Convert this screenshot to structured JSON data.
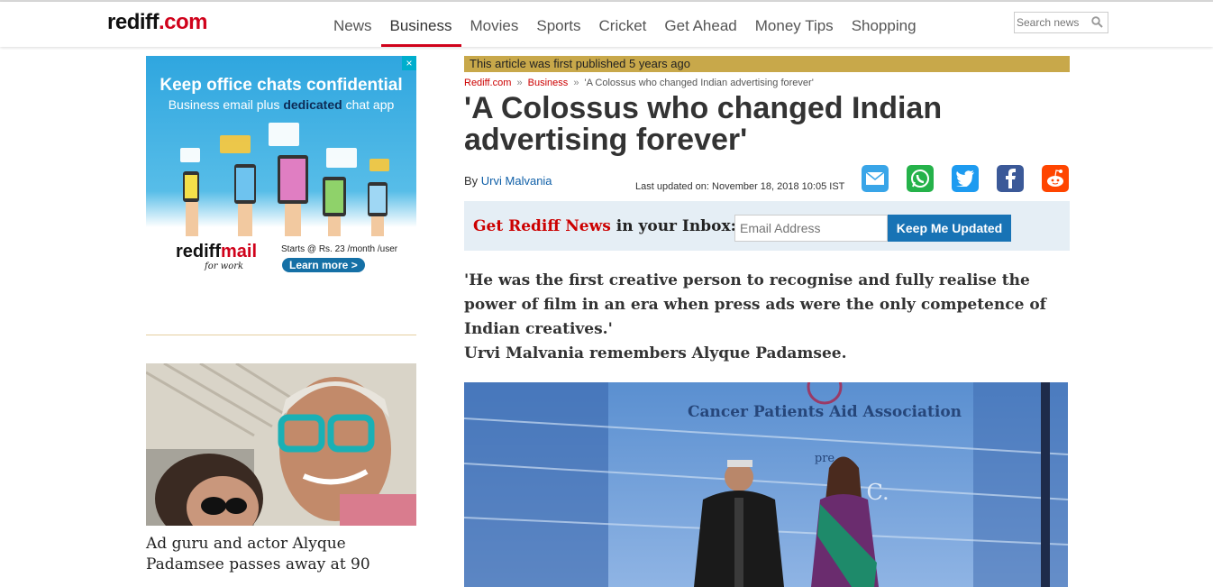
{
  "header": {
    "logo_main": "rediff",
    "logo_suffix": ".com",
    "nav": [
      "News",
      "Business",
      "Movies",
      "Sports",
      "Cricket",
      "Get Ahead",
      "Money Tips",
      "Shopping"
    ],
    "active_nav": "Business",
    "search_placeholder": "Search news"
  },
  "ad": {
    "close": "×",
    "headline": "Keep office chats confidential",
    "sub_before": "Business email plus ",
    "sub_strong": "dedicated",
    "sub_after": " chat app",
    "brand_a": "rediff",
    "brand_b": "mail",
    "brand_tag": "for work",
    "price": "Starts @ Rs. 23 /month /user",
    "cta": "Learn more >"
  },
  "sidebar_story": {
    "caption": "Ad guru and actor Alyque Padamsee passes away at 90"
  },
  "article": {
    "banner": "This article was first published 5 years ago",
    "breadcrumb": [
      {
        "label": "Rediff.com"
      },
      {
        "label": "Business"
      },
      {
        "label": "'A Colossus who changed Indian advertising forever'"
      }
    ],
    "breadcrumb_sep": "»",
    "title": "'A Colossus who changed Indian advertising forever'",
    "by_prefix": "By",
    "author": "Urvi Malvania",
    "updated": "Last updated on: November 18, 2018 10:05 IST",
    "share_icons": [
      "email-icon",
      "whatsapp-icon",
      "twitter-icon",
      "facebook-icon",
      "reddit-icon"
    ],
    "intro_quote": "'He was the first creative person to recognise and fully realise the power of film in an era when press ads were the only competence of Indian creatives.'",
    "intro_line": "Urvi Malvania remembers Alyque Padamsee.",
    "hero_text": "Cancer Patients Aid Association",
    "hero_text2": "pre",
    "hero_text3": "mi   C."
  },
  "newsletter": {
    "label_red": "Get Rediff News",
    "label_rest": " in your Inbox:",
    "placeholder": "Email Address",
    "button": "Keep Me Updated"
  },
  "colors": {
    "brand_red": "#d0021b",
    "banner_gold": "#c8a84a",
    "button_blue": "#1873b5",
    "newsletter_bg": "#e5eef5"
  }
}
